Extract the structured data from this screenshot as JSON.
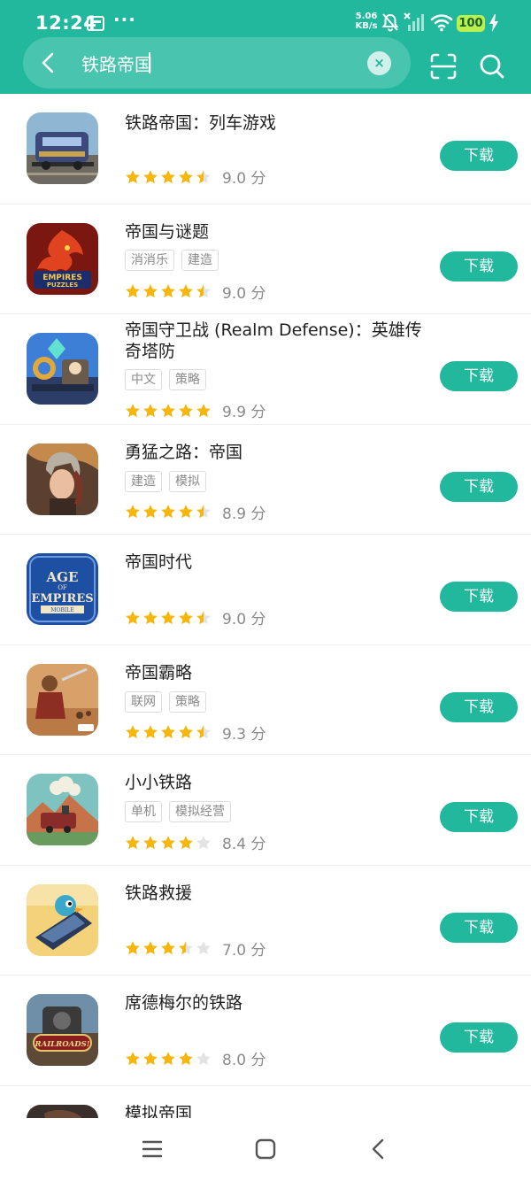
{
  "status_bar": {
    "time": "12:24",
    "more": "···",
    "net_speed_value": "5.06",
    "net_speed_unit": "KB/s",
    "battery": "100"
  },
  "search": {
    "query": "铁路帝国",
    "clear_label": "×"
  },
  "download_label": "下载",
  "score_unit": "分",
  "apps": [
    {
      "title": "铁路帝国：列车游戏",
      "tags": [],
      "rating": 4.5,
      "score": "9.0",
      "icon": "railway-empire-train-icon"
    },
    {
      "title": "帝国与谜题",
      "tags": [
        "消消乐",
        "建造"
      ],
      "rating": 4.5,
      "score": "9.0",
      "icon": "empires-puzzles-dragon-icon"
    },
    {
      "title": "帝国守卫战 (Realm Defense)：英雄传奇塔防",
      "tags": [
        "中文",
        "策略"
      ],
      "rating": 5,
      "score": "9.9",
      "icon": "realm-defense-tower-icon"
    },
    {
      "title": "勇猛之路：帝国",
      "tags": [
        "建造",
        "模拟"
      ],
      "rating": 4.5,
      "score": "8.9",
      "icon": "warrior-woman-helmet-icon"
    },
    {
      "title": "帝国时代",
      "tags": [],
      "rating": 4.5,
      "score": "9.0",
      "icon": "age-of-empires-mobile-icon"
    },
    {
      "title": "帝国霸略",
      "tags": [
        "联网",
        "策略"
      ],
      "rating": 4.5,
      "score": "9.3",
      "icon": "march-of-empires-warrior-icon"
    },
    {
      "title": "小小铁路",
      "tags": [
        "单机",
        "模拟经营"
      ],
      "rating": 4,
      "score": "8.4",
      "icon": "tiny-rails-train-icon"
    },
    {
      "title": "铁路救援",
      "tags": [],
      "rating": 3.5,
      "score": "7.0",
      "icon": "cartoon-train-bird-icon"
    },
    {
      "title": "席德梅尔的铁路",
      "tags": [],
      "rating": 4,
      "score": "8.0",
      "icon": "railroads-logo-icon"
    },
    {
      "title": "模拟帝国",
      "tags": [],
      "rating": 0,
      "score": "",
      "icon": "empire-sim-icon"
    }
  ],
  "icon_texts": {
    "empires_line1": "EMPIRES",
    "empires_line2": "PUZZLES",
    "aoe_line1": "AGE",
    "aoe_line2": "OF",
    "aoe_line3": "EMPIRES",
    "aoe_line4": "MOBILE",
    "railroads": "RAILROADS!"
  },
  "colors": {
    "accent": "#22b89d",
    "star_filled": "#f5b70f",
    "star_empty": "#e3e3e3",
    "tag_text": "#8a8a8a"
  }
}
